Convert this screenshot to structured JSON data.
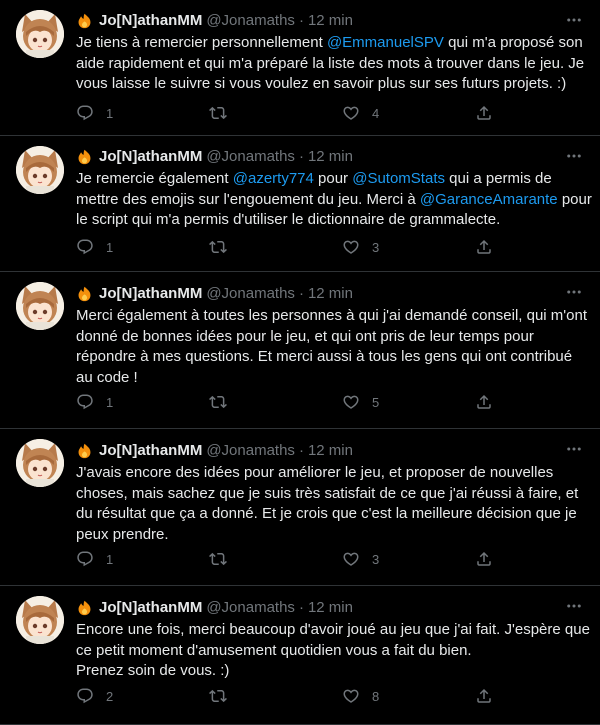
{
  "tweets": [
    {
      "name": "Jo[N]athanMM",
      "handle": "@Jonamaths",
      "time": "12 min",
      "text": [
        {
          "t": "Je tiens à remercier personnellement "
        },
        {
          "t": "@EmmanuelSPV",
          "m": true
        },
        {
          "t": " qui m'a proposé son aide rapidement et qui m'a préparé la liste des mots à trouver dans le jeu. Je vous laisse le suivre si vous voulez en savoir plus sur ses futurs projets. :)"
        }
      ],
      "replies": "1",
      "retweets": "",
      "likes": "4"
    },
    {
      "name": "Jo[N]athanMM",
      "handle": "@Jonamaths",
      "time": "12 min",
      "text": [
        {
          "t": "Je remercie également "
        },
        {
          "t": "@azerty774",
          "m": true
        },
        {
          "t": " pour "
        },
        {
          "t": "@SutomStats",
          "m": true
        },
        {
          "t": " qui a permis de mettre des emojis sur l'engouement du jeu. Merci à "
        },
        {
          "t": "@GaranceAmarante",
          "m": true
        },
        {
          "t": " pour le script qui m'a permis d'utiliser le dictionnaire de grammalecte."
        }
      ],
      "replies": "1",
      "retweets": "",
      "likes": "3"
    },
    {
      "name": "Jo[N]athanMM",
      "handle": "@Jonamaths",
      "time": "12 min",
      "text": [
        {
          "t": "Merci également à toutes les personnes à qui j'ai demandé conseil, qui m'ont donné de bonnes idées pour le jeu, et qui ont pris de leur temps pour répondre à mes questions. Et merci aussi à tous les gens qui ont contribué au code !"
        }
      ],
      "replies": "1",
      "retweets": "",
      "likes": "5"
    },
    {
      "name": "Jo[N]athanMM",
      "handle": "@Jonamaths",
      "time": "12 min",
      "text": [
        {
          "t": "J'avais encore des idées pour améliorer le jeu, et proposer de nouvelles choses, mais sachez que je suis très satisfait de ce que j'ai réussi à faire, et du résultat que ça a donné. Et je crois que c'est la meilleure décision que je peux prendre."
        }
      ],
      "replies": "1",
      "retweets": "",
      "likes": "3"
    },
    {
      "name": "Jo[N]athanMM",
      "handle": "@Jonamaths",
      "time": "12 min",
      "text": [
        {
          "t": "Encore une fois, merci beaucoup d'avoir joué au jeu que j'ai fait. J'espère que ce petit moment d'amusement quotidien vous a fait du bien.\nPrenez soin de vous. :)"
        }
      ],
      "replies": "2",
      "retweets": "",
      "likes": "8"
    }
  ],
  "colors": {
    "background": "#000000",
    "text": "#e7e9ea",
    "muted": "#71767b",
    "link": "#1d9bf0",
    "badge": "#f4900c"
  },
  "icons": {
    "badge": "fire-logo-icon",
    "more": "more-icon",
    "reply": "reply-icon",
    "retweet": "retweet-icon",
    "like": "heart-icon",
    "share": "share-icon"
  }
}
